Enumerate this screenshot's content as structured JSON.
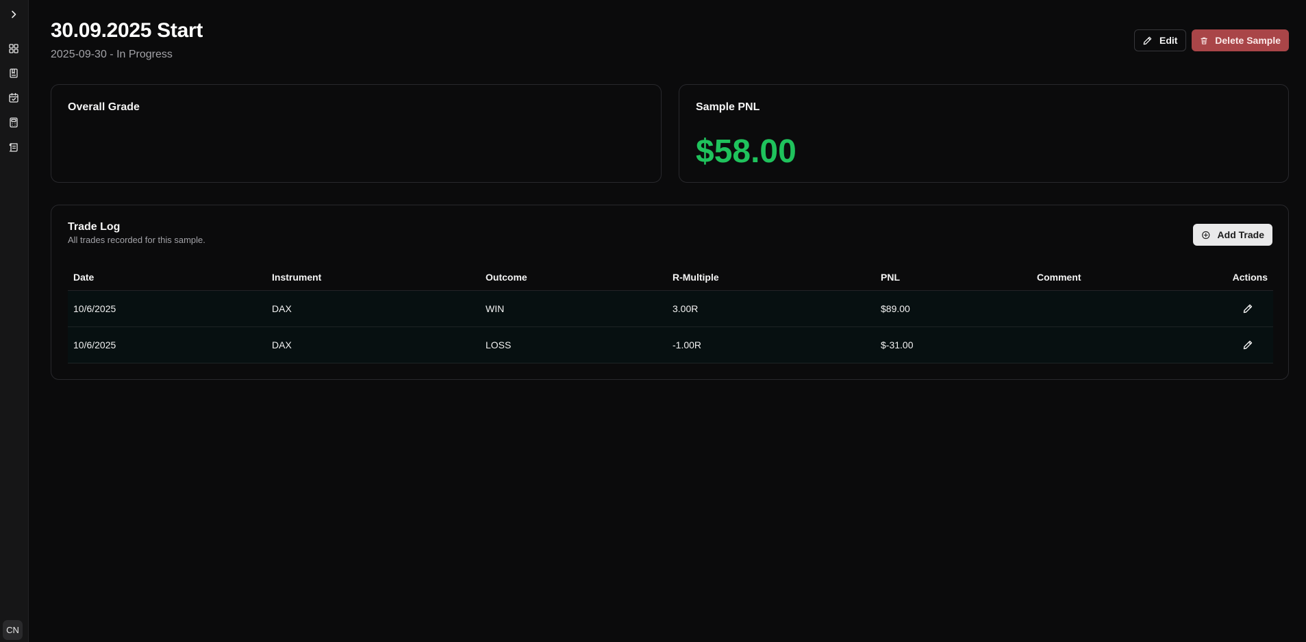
{
  "sidebar": {
    "items": [
      {
        "icon": "chevron-right-icon"
      },
      {
        "icon": "dashboard-grid-icon"
      },
      {
        "icon": "notebook-icon"
      },
      {
        "icon": "calendar-check-icon"
      },
      {
        "icon": "calculator-icon"
      },
      {
        "icon": "scroll-icon"
      }
    ],
    "avatar": "CN"
  },
  "header": {
    "title": "30.09.2025 Start",
    "subtitle": "2025-09-30 - In Progress",
    "edit_label": "Edit",
    "delete_label": "Delete Sample"
  },
  "grade_card": {
    "title": "Overall Grade"
  },
  "pnl_card": {
    "title": "Sample PNL",
    "value": "$58.00"
  },
  "trade_log": {
    "title": "Trade Log",
    "subtitle": "All trades recorded for this sample.",
    "add_label": "Add Trade",
    "columns": {
      "date": "Date",
      "instrument": "Instrument",
      "outcome": "Outcome",
      "r_multiple": "R-Multiple",
      "pnl": "PNL",
      "comment": "Comment",
      "actions": "Actions"
    },
    "rows": [
      {
        "date": "10/6/2025",
        "instrument": "DAX",
        "outcome": "WIN",
        "r_multiple": "3.00R",
        "pnl": "$89.00",
        "comment": ""
      },
      {
        "date": "10/6/2025",
        "instrument": "DAX",
        "outcome": "LOSS",
        "r_multiple": "-1.00R",
        "pnl": "$-31.00",
        "comment": ""
      }
    ]
  },
  "colors": {
    "background": "#0b0b0c",
    "positive": "#1fc25c",
    "danger": "#a94548"
  }
}
